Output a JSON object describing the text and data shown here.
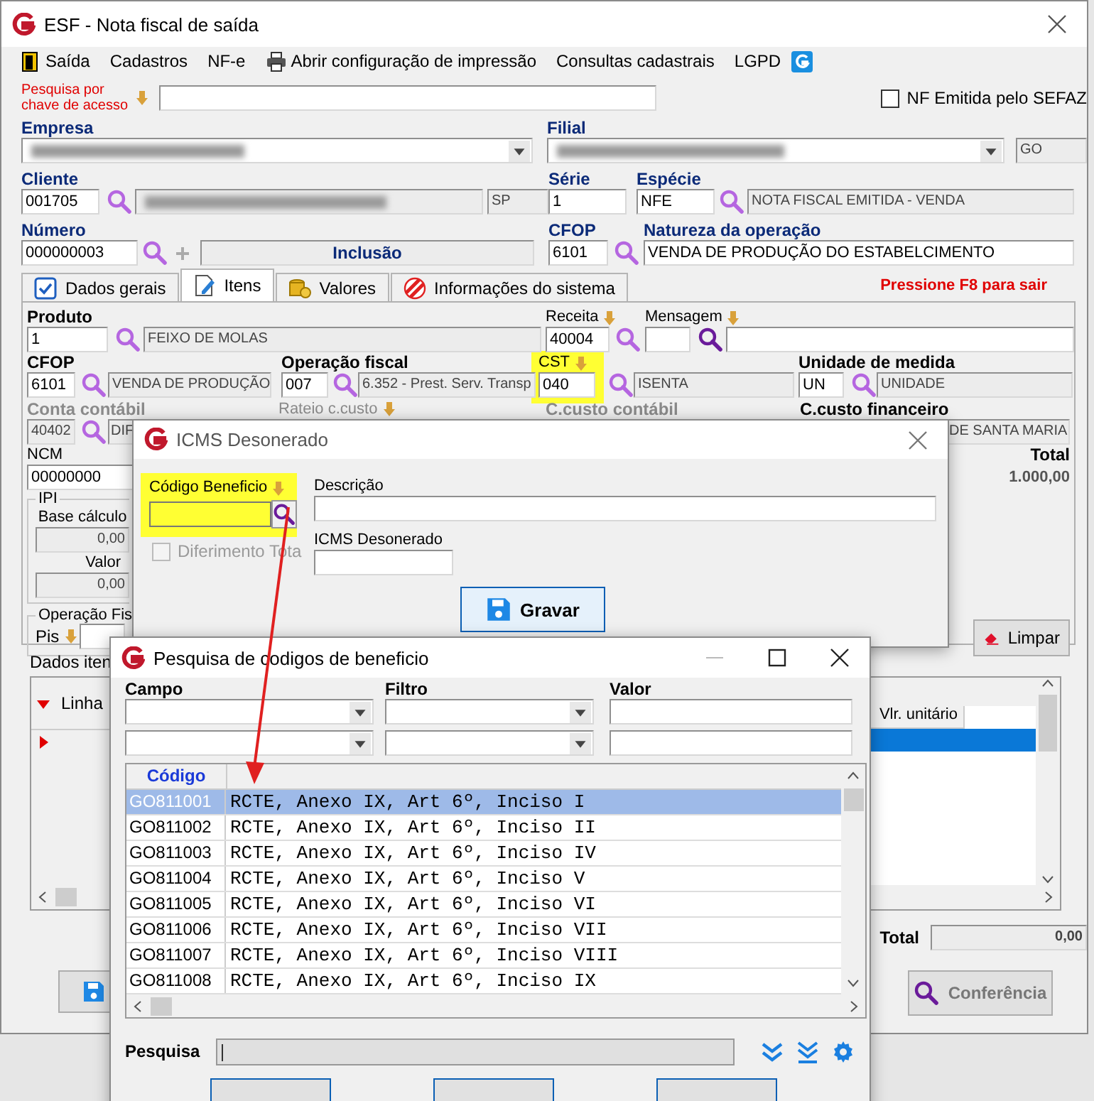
{
  "window": {
    "title": "ESF - Nota fiscal de saída"
  },
  "menu": [
    {
      "label": "Saída"
    },
    {
      "label": "Cadastros"
    },
    {
      "label": "NF-e"
    },
    {
      "label": "Abrir configuração de impressão"
    },
    {
      "label": "Consultas cadastrais"
    },
    {
      "label": "LGPD"
    }
  ],
  "access_key_search": {
    "label": "Pesquisa por chave de acesso"
  },
  "sefaz_checkbox": {
    "label": "NF Emitida pelo SEFAZ",
    "checked": false
  },
  "empresa": {
    "label": "Empresa"
  },
  "filial": {
    "label": "Filial",
    "uf": "GO"
  },
  "cliente": {
    "label": "Cliente",
    "code": "001705",
    "uf": "SP"
  },
  "serie": {
    "label": "Série",
    "value": "1"
  },
  "especie": {
    "label": "Espécie",
    "code": "NFE",
    "description": "NOTA FISCAL EMITIDA - VENDA"
  },
  "numero": {
    "label": "Número",
    "value": "000000003",
    "status": "Inclusão"
  },
  "cfop": {
    "label": "CFOP",
    "value": "6101"
  },
  "natureza": {
    "label": "Natureza da operação",
    "value": "VENDA DE PRODUÇÃO DO ESTABELCIMENTO"
  },
  "tabs": [
    {
      "label": "Dados gerais",
      "selected": false
    },
    {
      "label": "Itens",
      "selected": true
    },
    {
      "label": "Valores",
      "selected": false
    },
    {
      "label": "Informações do sistema",
      "selected": false
    }
  ],
  "exit_hint": "Pressione F8 para sair",
  "item": {
    "produto": {
      "label": "Produto",
      "code": "1",
      "description": "FEIXO DE MOLAS"
    },
    "receita": {
      "label": "Receita",
      "value": "40004"
    },
    "mensagem": {
      "label": "Mensagem"
    },
    "cfop": {
      "label": "CFOP",
      "code": "6101",
      "description": "VENDA DE PRODUÇÃO"
    },
    "operacao_fiscal": {
      "label": "Operação fiscal",
      "code": "007",
      "description": "6.352 - Prest. Serv. Transp"
    },
    "cst": {
      "label": "CST",
      "code": "040",
      "description": "ISENTA",
      "highlighted": true
    },
    "unidade": {
      "label": "Unidade de medida",
      "code": "UN",
      "description": "UNIDADE"
    },
    "conta_contabil": {
      "label": "Conta contábil",
      "code": "40402",
      "description": "DIF",
      "disabled": true
    },
    "rateio": {
      "label": "Rateio c.custo",
      "disabled": true
    },
    "ccusto_contabil": {
      "label": "C.custo contábil",
      "disabled": true
    },
    "ccusto_financeiro": {
      "label": "C.custo financeiro",
      "description": "DE SANTA MARIA",
      "disabled": false
    },
    "ncm": {
      "label": "NCM",
      "value": "00000000"
    },
    "total": {
      "label": "Total",
      "value": "1.000,00"
    },
    "ipi": {
      "title": "IPI",
      "base_label": "Base cálculo",
      "base": "0,00",
      "valor_label": "Valor",
      "valor": "0,00"
    },
    "operacao_group": {
      "title": "Operação Fis",
      "pis_label": "Pis"
    },
    "clear_button": "Limpar"
  },
  "items_tab": "Dados iten",
  "items_grid": {
    "columns": [
      "Linha",
      "Vlr. unitário"
    ]
  },
  "footer": {
    "total_label": "Total",
    "total": "0,00",
    "check_button": "Conferência"
  },
  "icms_dialog": {
    "title": "ICMS Desonerado",
    "active": false,
    "codigo": {
      "label": "Código Beneficio",
      "highlighted": true
    },
    "descricao_label": "Descrição",
    "deferral": {
      "label": "Diferimento Tota",
      "checked": false,
      "disabled": true
    },
    "icms_label": "ICMS Desonerado",
    "save_button": "Gravar"
  },
  "search_dialog": {
    "title": "Pesquisa de codigos de beneficio",
    "active": true,
    "filter_labels": [
      "Campo",
      "Filtro",
      "Valor"
    ],
    "grid": {
      "columns": [
        "Código"
      ],
      "rows": [
        {
          "code": "GO811001",
          "description": "RCTE, Anexo IX, Art 6º, Inciso I",
          "selected": true
        },
        {
          "code": "GO811002",
          "description": "RCTE, Anexo IX, Art 6º, Inciso II",
          "selected": false
        },
        {
          "code": "GO811003",
          "description": "RCTE, Anexo IX, Art 6º, Inciso IV",
          "selected": false
        },
        {
          "code": "GO811004",
          "description": "RCTE, Anexo IX, Art 6º, Inciso V",
          "selected": false
        },
        {
          "code": "GO811005",
          "description": "RCTE, Anexo IX, Art 6º, Inciso VI",
          "selected": false
        },
        {
          "code": "GO811006",
          "description": "RCTE, Anexo IX, Art 6º, Inciso VII",
          "selected": false
        },
        {
          "code": "GO811007",
          "description": "RCTE, Anexo IX, Art 6º, Inciso VIII",
          "selected": false
        },
        {
          "code": "GO811008",
          "description": "RCTE, Anexo IX, Art 6º, Inciso IX",
          "selected": false
        }
      ]
    },
    "search_label": "Pesquisa"
  }
}
